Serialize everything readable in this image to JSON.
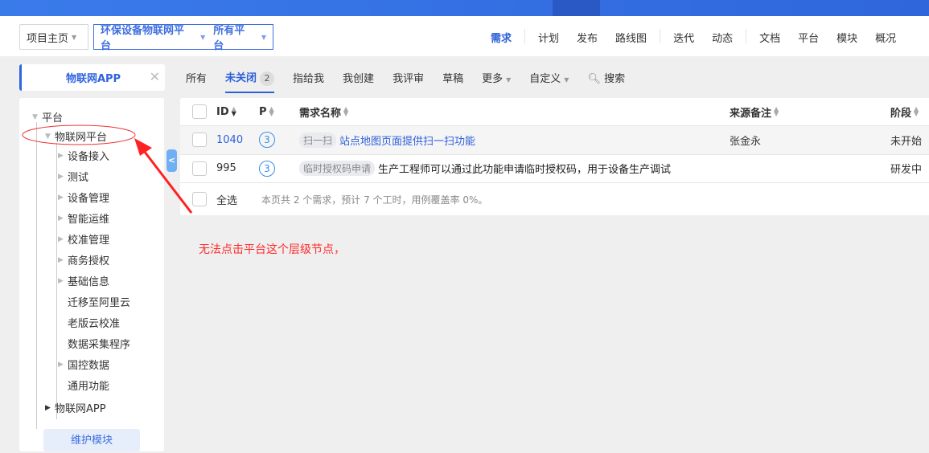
{
  "breadcrumb": {
    "home": "项目主页",
    "product": "环保设备物联网平台",
    "branch": "所有平台"
  },
  "nav": [
    "需求",
    "计划",
    "发布",
    "路线图",
    "迭代",
    "动态",
    "文档",
    "平台",
    "模块",
    "概况"
  ],
  "module_tab": {
    "label": "物联网APP"
  },
  "tree": {
    "root": "平台",
    "node": "物联网平台",
    "children": [
      "设备接入",
      "测试",
      "设备管理",
      "智能运维",
      "校准管理",
      "商务授权",
      "基础信息",
      "迁移至阿里云",
      "老版云校准",
      "数据采集程序",
      "国控数据",
      "通用功能"
    ],
    "expandable": [
      true,
      true,
      true,
      true,
      true,
      true,
      true,
      false,
      false,
      false,
      true,
      false
    ],
    "sibling": "物联网APP",
    "maintain": "维护模块"
  },
  "tabs": {
    "all": "所有",
    "unclosed": "未关闭",
    "unclosed_count": "2",
    "assigned": "指给我",
    "created": "我创建",
    "reviewed": "我评审",
    "draft": "草稿",
    "more": "更多",
    "custom": "自定义",
    "search": "搜索"
  },
  "table": {
    "headers": {
      "id": "ID",
      "p": "P",
      "name": "需求名称",
      "source": "来源备注",
      "stage": "阶段"
    },
    "rows": [
      {
        "id": "1040",
        "p": "3",
        "tag": "扫一扫",
        "name": "站点地图页面提供扫一扫功能",
        "source": "张金永",
        "stage": "未开始"
      },
      {
        "id": "995",
        "p": "3",
        "tag": "临时授权码申请",
        "name": "生产工程师可以通过此功能申请临时授权码，用于设备生产调试",
        "source": "",
        "stage": "研发中"
      }
    ],
    "select_all": "全选",
    "summary": "本页共 2 个需求，预计 7 个工时，用例覆盖率 0%。"
  },
  "annotation": "无法点击平台这个层级节点，",
  "colors": {
    "accent": "#2c5fd9",
    "annotation": "#ff2a2a"
  }
}
